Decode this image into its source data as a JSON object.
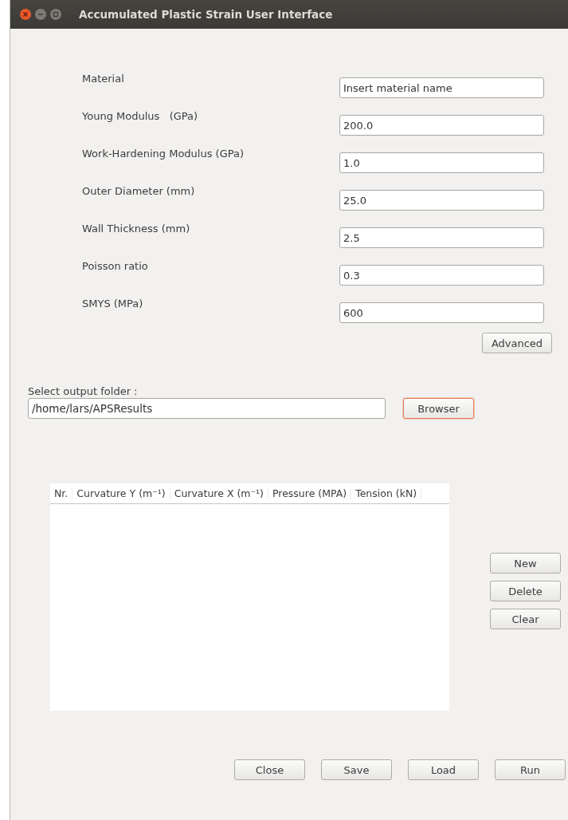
{
  "window": {
    "title": "Accumulated Plastic Strain User Interface"
  },
  "form": [
    {
      "label": "Material",
      "placeholder": "Insert material name"
    },
    {
      "label": "Young Modulus   (GPa)",
      "value": "200.0"
    },
    {
      "label": "Work-Hardening Modulus (GPa)",
      "value": "1.0"
    },
    {
      "label": "Outer Diameter (mm)",
      "value": "25.0"
    },
    {
      "label": "Wall Thickness (mm)",
      "value": "2.5"
    },
    {
      "label": "Poisson ratio",
      "value": "0.3"
    },
    {
      "label": "SMYS (MPa)",
      "value": "600"
    }
  ],
  "advanced_button": "Advanced",
  "output": {
    "label": "Select output folder :",
    "value": "/home/lars/APSResults",
    "browse_button": {
      "label": "Browser",
      "focused": true
    }
  },
  "table": {
    "columns": [
      "Nr.",
      "Curvature Y (m⁻¹)",
      "Curvature X (m⁻¹)",
      "Pressure (MPA)",
      "Tension (kN)"
    ]
  },
  "side_buttons": [
    "New",
    "Delete",
    "Clear"
  ],
  "buttons": [
    "Close",
    "Save",
    "Load",
    "Run"
  ]
}
